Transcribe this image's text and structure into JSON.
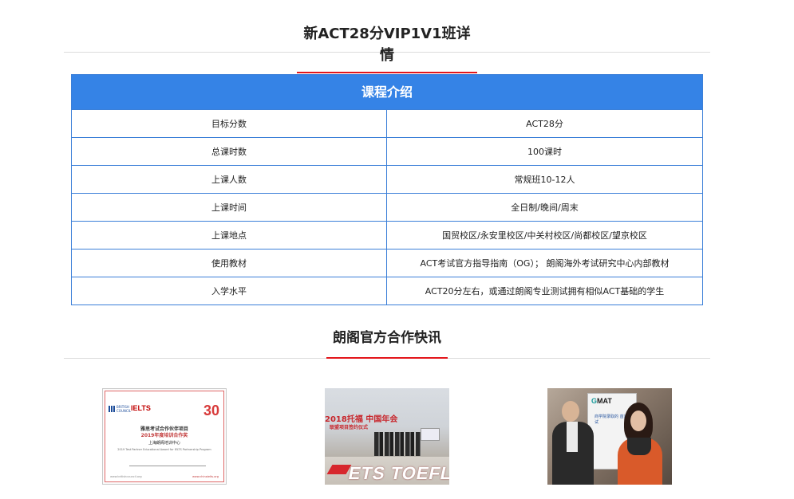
{
  "section1": {
    "title": "新ACT28分VIP1V1班详情"
  },
  "course_table": {
    "header": "课程介绍",
    "rows": [
      {
        "label": "目标分数",
        "value": "ACT28分"
      },
      {
        "label": "总课时数",
        "value": "100课时"
      },
      {
        "label": "上课人数",
        "value": "常规班10-12人"
      },
      {
        "label": "上课时间",
        "value": "全日制/晚间/周末"
      },
      {
        "label": "上课地点",
        "value": "国贸校区/永安里校区/中关村校区/尚都校区/望京校区"
      },
      {
        "label": "使用教材",
        "value": "ACT考试官方指导指南（OG）； 朗阁海外考试研究中心内部教材"
      },
      {
        "label": "入学水平",
        "value": "ACT20分左右，或通过朗阁专业测试拥有相似ACT基础的学生"
      }
    ]
  },
  "section2": {
    "title": "朗阁官方合作快讯"
  },
  "photos": {
    "certificate": {
      "council": "BRITISH COUNCIL",
      "brand": "IELTS",
      "anniversary": "30",
      "line1": "雅思考试合作伙伴项目",
      "line2": "2019年度培训合作奖",
      "line3": "上海朗阁培训中心",
      "line4": "2019 Test Partner Educational Award for IELTS Partnership Program",
      "footer_left": "www.britishcouncil.org",
      "footer_right": "www.chinaielts.org"
    },
    "ets": {
      "banner": "2018托福 中国年会",
      "subtitle": "联盟项目签约仪式",
      "logo": "ETS TOEFL"
    },
    "gmat": {
      "logo_prefix": "G",
      "logo_suffix": "MAT",
      "board_text": "商学院录取的 首选考试"
    }
  }
}
